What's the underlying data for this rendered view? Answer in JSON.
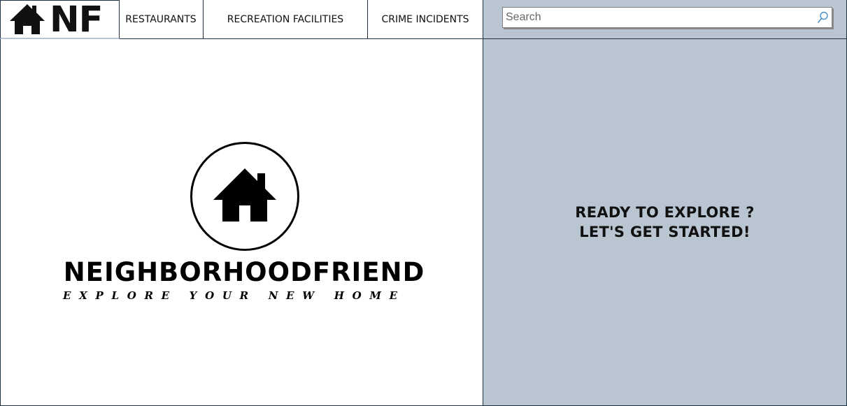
{
  "nav": {
    "logo_text": "NF",
    "tabs": [
      {
        "label": "RESTAURANTS"
      },
      {
        "label": "RECREATION FACILITIES"
      },
      {
        "label": "CRIME INCIDENTS"
      }
    ]
  },
  "search": {
    "placeholder": "Search",
    "icon": "search-icon"
  },
  "hero": {
    "brand": "NEIGHBORHOODFRIEND",
    "tagline": "EXPLORE YOUR NEW HOME",
    "icon": "house-icon"
  },
  "panel": {
    "line1": "READY TO EXPLORE ?",
    "line2": "LET'S GET STARTED!"
  },
  "colors": {
    "panel_bg": "#b9c6d2",
    "border": "#1f3142"
  }
}
